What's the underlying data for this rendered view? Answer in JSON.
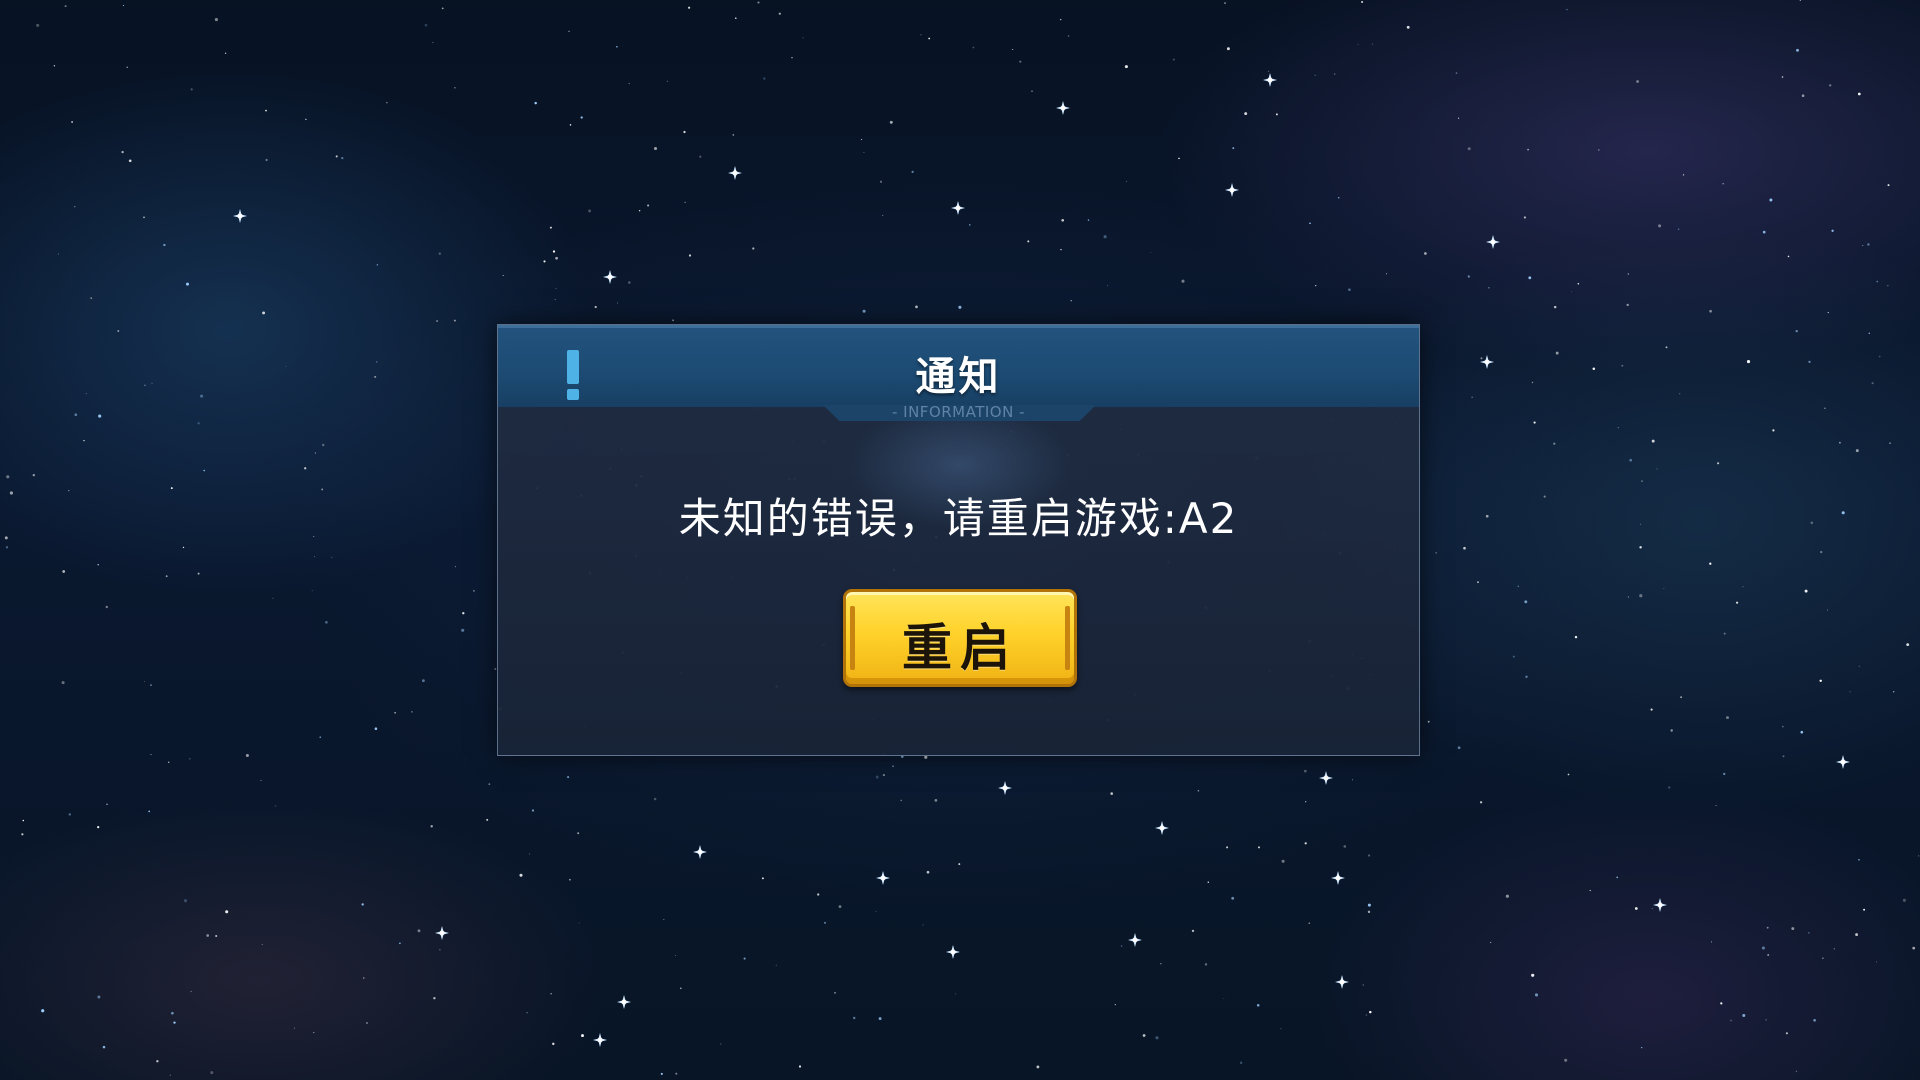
{
  "dialog": {
    "title": "通知",
    "subtitle": "- INFORMATION -",
    "message": "未知的错误，请重启游戏:A2",
    "button_label": "重启",
    "icon": "exclamation-icon"
  },
  "colors": {
    "header": "#1c4a72",
    "button": "#ffd22a",
    "icon": "#4fb2e6"
  }
}
